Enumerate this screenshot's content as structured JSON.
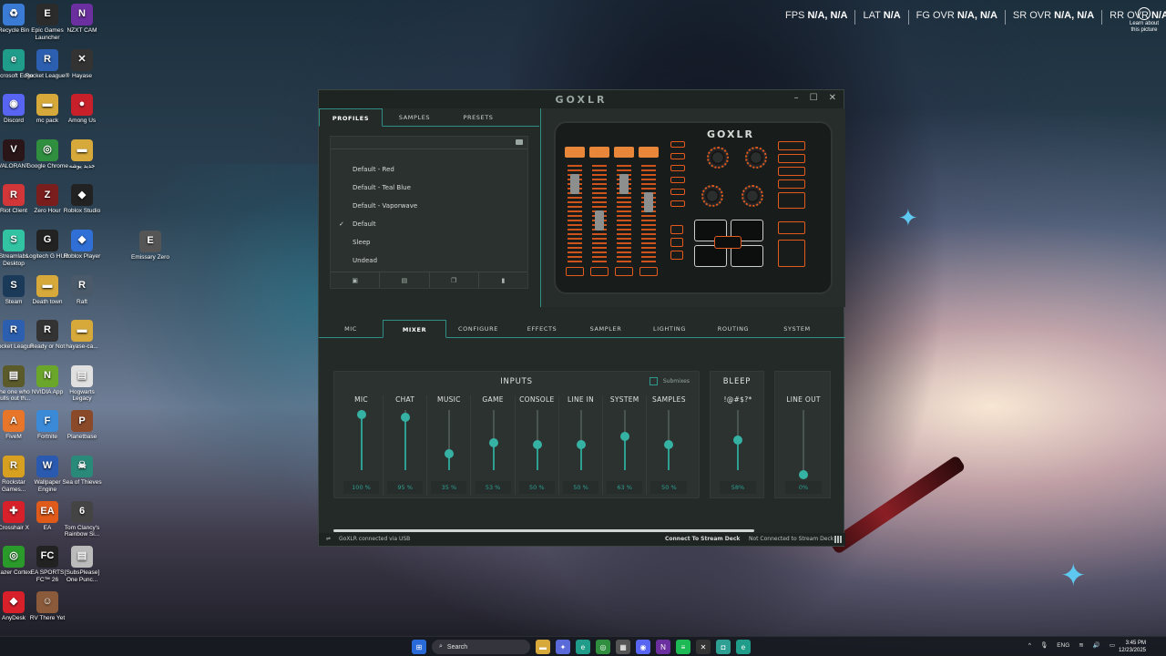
{
  "desktop_icons": [
    {
      "label": "Recycle Bin",
      "icon": "recycle-bin-icon",
      "color": "#3a7bd5",
      "glyph": "♻"
    },
    {
      "label": "Epic Games Launcher",
      "icon": "epic-games-icon",
      "color": "#2b2b2b",
      "glyph": "E"
    },
    {
      "label": "NZXT CAM",
      "icon": "nzxt-cam-icon",
      "color": "#6b2fa0",
      "glyph": "N"
    },
    {
      "label": "Microsoft Edge",
      "icon": "edge-icon",
      "color": "#1f9c8a",
      "glyph": "e"
    },
    {
      "label": "Rocket League®",
      "icon": "rocket-league-icon",
      "color": "#2c5fb0",
      "glyph": "R"
    },
    {
      "label": "Hayase",
      "icon": "hayase-icon",
      "color": "#333",
      "glyph": "✕"
    },
    {
      "label": "Discord",
      "icon": "discord-icon",
      "color": "#5865f2",
      "glyph": "◉"
    },
    {
      "label": "mc pack",
      "icon": "folder-icon",
      "color": "#d6a93a",
      "glyph": "▬"
    },
    {
      "label": "Among Us",
      "icon": "among-us-icon",
      "color": "#c8202b",
      "glyph": "●"
    },
    {
      "label": "VALORANT",
      "icon": "valorant-icon",
      "color": "#2a1518",
      "glyph": "V"
    },
    {
      "label": "Google Chrome",
      "icon": "chrome-icon",
      "color": "#2f8f3f",
      "glyph": "◎"
    },
    {
      "label": "جدید پوشه",
      "icon": "folder-icon",
      "color": "#d6a93a",
      "glyph": "▬"
    },
    {
      "label": "Riot Client",
      "icon": "riot-client-icon",
      "color": "#d13639",
      "glyph": "R"
    },
    {
      "label": "Zero Hour",
      "icon": "zero-hour-icon",
      "color": "#7a1d1d",
      "glyph": "Z"
    },
    {
      "label": "Roblox Studio",
      "icon": "roblox-studio-icon",
      "color": "#222",
      "glyph": "◆"
    },
    {
      "label": "Streamlabs Desktop",
      "icon": "streamlabs-icon",
      "color": "#31c3a2",
      "glyph": "S"
    },
    {
      "label": "Logitech G HUB",
      "icon": "logitech-icon",
      "color": "#222",
      "glyph": "G"
    },
    {
      "label": "Roblox Player",
      "icon": "roblox-player-icon",
      "color": "#2f6fd6",
      "glyph": "◆"
    },
    {
      "label": "Emissary Zero",
      "icon": "emissary-zero-icon",
      "color": "#555",
      "glyph": "E"
    },
    {
      "label": "Steam",
      "icon": "steam-icon",
      "color": "#1b3a5a",
      "glyph": "S"
    },
    {
      "label": "Death town",
      "icon": "folder-icon",
      "color": "#d6a93a",
      "glyph": "▬"
    },
    {
      "label": "Raft",
      "icon": "raft-icon",
      "color": "#4a5a6a",
      "glyph": "R"
    },
    {
      "label": "Rocket League",
      "icon": "rocket-league-icon",
      "color": "#2c5fb0",
      "glyph": "R"
    },
    {
      "label": "Ready or Not",
      "icon": "ready-or-not-icon",
      "color": "#333",
      "glyph": "R"
    },
    {
      "label": "hayase-ca...",
      "icon": "folder-icon",
      "color": "#d6a93a",
      "glyph": "▬"
    },
    {
      "label": "the one who pulls out th...",
      "icon": "file-icon",
      "color": "#5a5a2a",
      "glyph": "▤"
    },
    {
      "label": "NVIDIA App",
      "icon": "nvidia-icon",
      "color": "#6aa62a",
      "glyph": "N"
    },
    {
      "label": "Hogwarts Legacy",
      "icon": "file-icon",
      "color": "#e0e0e0",
      "glyph": "▤"
    },
    {
      "label": "FiveM",
      "icon": "fivem-icon",
      "color": "#e8762a",
      "glyph": "A"
    },
    {
      "label": "Fortnite",
      "icon": "fortnite-icon",
      "color": "#3a8ad8",
      "glyph": "F"
    },
    {
      "label": "Planetbase",
      "icon": "planetbase-icon",
      "color": "#8a4a2a",
      "glyph": "P"
    },
    {
      "label": "Rockstar Games...",
      "icon": "rockstar-icon",
      "color": "#d8a020",
      "glyph": "R"
    },
    {
      "label": "Wallpaper Engine",
      "icon": "wallpaper-engine-icon",
      "color": "#2a5ab0",
      "glyph": "W"
    },
    {
      "label": "Sea of Thieves",
      "icon": "sea-of-thieves-icon",
      "color": "#2a8a7a",
      "glyph": "☠"
    },
    {
      "label": "Crosshair X",
      "icon": "crosshair-x-icon",
      "color": "#d8202a",
      "glyph": "✚"
    },
    {
      "label": "EA",
      "icon": "ea-icon",
      "color": "#e05a1a",
      "glyph": "EA"
    },
    {
      "label": "Tom Clancy's Rainbow Si...",
      "icon": "rainbow-six-icon",
      "color": "#444",
      "glyph": "6"
    },
    {
      "label": "Razer Cortex",
      "icon": "razer-cortex-icon",
      "color": "#2a9a2a",
      "glyph": "◎"
    },
    {
      "label": "EA SPORTS FC™ 26",
      "icon": "ea-fc-icon",
      "color": "#222",
      "glyph": "FC"
    },
    {
      "label": "[SubsPlease] One Punc...",
      "icon": "video-file-icon",
      "color": "#bbb",
      "glyph": "▤"
    },
    {
      "label": "AnyDesk",
      "icon": "anydesk-icon",
      "color": "#d8202a",
      "glyph": "◆"
    },
    {
      "label": "RV There Yet",
      "icon": "rv-there-yet-icon",
      "color": "#8a5a3a",
      "glyph": "☺"
    }
  ],
  "overlay": {
    "fps_label": "FPS",
    "fps_value": "N/A, N/A",
    "lat_label": "LAT",
    "lat_value": "N/A",
    "fg_label": "FG OVR",
    "fg_value": "N/A, N/A",
    "sr_label": "SR OVR",
    "sr_value": "N/A, N/A",
    "rr_label": "RR OVR",
    "rr_value": "N/A, N/A",
    "learn_more": "Learn about this picture"
  },
  "goxlr": {
    "title": "GOXLR",
    "device_logo": "GOXLR",
    "window_controls": {
      "minimize": "–",
      "maximize": "☐",
      "close": "✕"
    },
    "profile_tabs": [
      "PROFILES",
      "SAMPLES",
      "PRESETS"
    ],
    "active_profile_tab": "PROFILES",
    "profiles": [
      {
        "name": "Default - Red",
        "checked": false
      },
      {
        "name": "Default - Teal Blue",
        "checked": false
      },
      {
        "name": "Default - Vaporwave",
        "checked": false
      },
      {
        "name": "Default",
        "checked": true
      },
      {
        "name": "Sleep",
        "checked": false
      },
      {
        "name": "Undead",
        "checked": false
      }
    ],
    "check_glyph": "✓",
    "profile_actions": [
      {
        "icon": "save-icon",
        "glyph": "▣"
      },
      {
        "icon": "new-icon",
        "glyph": "▤"
      },
      {
        "icon": "copy-icon",
        "glyph": "❐"
      },
      {
        "icon": "delete-icon",
        "glyph": "▮"
      }
    ],
    "main_tabs": [
      "MIC",
      "MIXER",
      "CONFIGURE",
      "EFFECTS",
      "SAMPLER",
      "LIGHTING",
      "ROUTING",
      "SYSTEM"
    ],
    "active_main_tab": "MIXER",
    "inputs_title": "INPUTS",
    "submixes_label": "Submixes",
    "channels": [
      {
        "name": "MIC",
        "level": 1.0,
        "value": "100 %"
      },
      {
        "name": "CHAT",
        "level": 0.95,
        "value": "95 %"
      },
      {
        "name": "MUSIC",
        "level": 0.35,
        "value": "35 %"
      },
      {
        "name": "GAME",
        "level": 0.53,
        "value": "53 %"
      },
      {
        "name": "CONSOLE",
        "level": 0.5,
        "value": "50 %"
      },
      {
        "name": "LINE IN",
        "level": 0.5,
        "value": "50 %"
      },
      {
        "name": "SYSTEM",
        "level": 0.63,
        "value": "63 %"
      },
      {
        "name": "SAMPLES",
        "level": 0.5,
        "value": "50 %"
      }
    ],
    "bleep": {
      "title": "BLEEP",
      "name": "!@#$?*",
      "level": 0.58,
      "value": "58%"
    },
    "outputs": {
      "title": "",
      "channels": [
        {
          "name": "LINE OUT",
          "level": 0.0,
          "value": "0%"
        }
      ]
    },
    "status": {
      "connection": "GoXLR connected via USB",
      "stream_deck_button": "Connect To Stream Deck",
      "stream_deck_status": "Not Connected to Stream Deck"
    },
    "accent_color": "#2e9f93",
    "device_accent": "#e35a1c"
  },
  "taskbar": {
    "search_placeholder": "Search",
    "apps": [
      {
        "icon": "file-explorer-icon",
        "color": "#d6a93a",
        "glyph": "▬"
      },
      {
        "icon": "copilot-icon",
        "color": "#5a6ad8",
        "glyph": "✦"
      },
      {
        "icon": "edge-icon",
        "color": "#1f9c8a",
        "glyph": "e"
      },
      {
        "icon": "chrome-icon",
        "color": "#2f8f3f",
        "glyph": "◎"
      },
      {
        "icon": "store-icon",
        "color": "#555",
        "glyph": "▦"
      },
      {
        "icon": "discord-icon",
        "color": "#5865f2",
        "glyph": "◉"
      },
      {
        "icon": "nzxt-cam-icon",
        "color": "#6b2fa0",
        "glyph": "N"
      },
      {
        "icon": "spotify-icon",
        "color": "#1db954",
        "glyph": "≡"
      },
      {
        "icon": "xbox-icon",
        "color": "#333",
        "glyph": "✕"
      },
      {
        "icon": "goxlr-icon",
        "color": "#2e9f93",
        "glyph": "◘"
      },
      {
        "icon": "edge-icon",
        "color": "#1f9c8a",
        "glyph": "e"
      }
    ],
    "tray": {
      "chevron": "^",
      "mic": "🎙",
      "lang": "ENG",
      "wifi": "≋",
      "volume": "🔊",
      "battery": "▭"
    },
    "time": "3:45 PM",
    "date": "12/23/2025"
  }
}
